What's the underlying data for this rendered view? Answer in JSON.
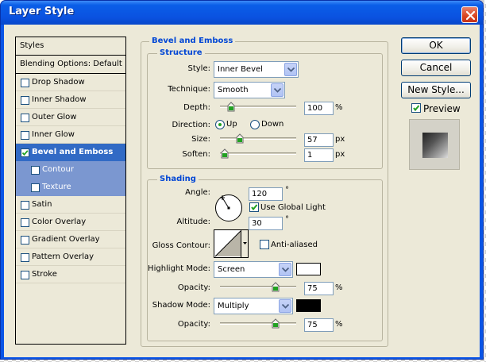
{
  "window": {
    "title": "Layer Style"
  },
  "sidebar": {
    "header": "Styles",
    "blending": "Blending Options: Default",
    "items": [
      {
        "label": "Drop Shadow",
        "checked": false
      },
      {
        "label": "Inner Shadow",
        "checked": false
      },
      {
        "label": "Outer Glow",
        "checked": false
      },
      {
        "label": "Inner Glow",
        "checked": false
      },
      {
        "label": "Bevel and Emboss",
        "checked": true,
        "selected": true
      },
      {
        "label": "Contour",
        "checked": false,
        "sub": true
      },
      {
        "label": "Texture",
        "checked": false,
        "sub": true
      },
      {
        "label": "Satin",
        "checked": false
      },
      {
        "label": "Color Overlay",
        "checked": false
      },
      {
        "label": "Gradient Overlay",
        "checked": false
      },
      {
        "label": "Pattern Overlay",
        "checked": false
      },
      {
        "label": "Stroke",
        "checked": false
      }
    ]
  },
  "bevel": {
    "title": "Bevel and Emboss",
    "structure": {
      "title": "Structure",
      "style_label": "Style:",
      "style_value": "Inner Bevel",
      "technique_label": "Technique:",
      "technique_value": "Smooth",
      "depth_label": "Depth:",
      "depth_value": "100",
      "depth_unit": "%",
      "depth_level": 0.1,
      "direction_label": "Direction:",
      "dir_up": "Up",
      "dir_down": "Down",
      "direction_selected": "Up",
      "size_label": "Size:",
      "size_value": "57",
      "size_unit": "px",
      "size_level": 0.23,
      "soften_label": "Soften:",
      "soften_value": "1",
      "soften_unit": "px",
      "soften_level": 0.01
    },
    "shading": {
      "title": "Shading",
      "angle_label": "Angle:",
      "angle_value": "120",
      "angle_unit": "°",
      "global_light_label": "Use Global Light",
      "global_light_checked": true,
      "altitude_label": "Altitude:",
      "altitude_value": "30",
      "altitude_unit": "°",
      "gloss_label": "Gloss Contour:",
      "antialiased_label": "Anti-aliased",
      "antialiased_checked": false,
      "highlight_label": "Highlight Mode:",
      "highlight_value": "Screen",
      "highlight_color": "#ffffff",
      "hl_opacity_label": "Opacity:",
      "hl_opacity_value": "75",
      "hl_opacity_unit": "%",
      "hl_opacity_level": 0.75,
      "shadow_label": "Shadow Mode:",
      "shadow_value": "Multiply",
      "shadow_color": "#000000",
      "sh_opacity_label": "Opacity:",
      "sh_opacity_value": "75",
      "sh_opacity_unit": "%",
      "sh_opacity_level": 0.75
    }
  },
  "actions": {
    "ok": "OK",
    "cancel": "Cancel",
    "new_style": "New Style...",
    "preview": "Preview",
    "preview_checked": true
  },
  "colors": {
    "accent": "#316ac5",
    "group_title": "#0046d5",
    "dialog_bg": "#ece9d8"
  }
}
